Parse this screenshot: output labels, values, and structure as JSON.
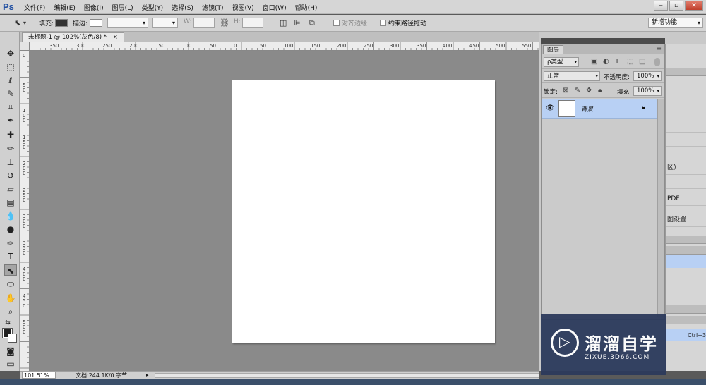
{
  "app": {
    "logo": "Ps"
  },
  "menu": [
    "文件(F)",
    "编辑(E)",
    "图像(I)",
    "图层(L)",
    "类型(Y)",
    "选择(S)",
    "滤镜(T)",
    "视图(V)",
    "窗口(W)",
    "帮助(H)"
  ],
  "window_controls": [
    "‒",
    "▫",
    "✕"
  ],
  "options": {
    "fill_label": "填充:",
    "stroke_label": "描边:",
    "w_label": "W:",
    "h_label": "H:",
    "align_edges": "对齐边缘",
    "constrain_path": "约束路径拖动",
    "workspace": "新增功能"
  },
  "document": {
    "tab_title": "未标题-1 @ 102%(灰色/8) *",
    "close": "×"
  },
  "ruler_top_labels": [
    "350",
    "300",
    "250",
    "200",
    "150",
    "100",
    "50",
    "0",
    "50",
    "100",
    "150",
    "200",
    "250",
    "300",
    "350",
    "400",
    "450",
    "500",
    "550",
    "600",
    "650",
    "700",
    "750",
    "800",
    "850"
  ],
  "ruler_left_labels": [
    "0",
    "50",
    "100",
    "150",
    "200",
    "250",
    "300",
    "350",
    "400",
    "450",
    "500"
  ],
  "status": {
    "zoom": "101.51%",
    "doc_info": "文档:244.1K/0 字节"
  },
  "layers_panel": {
    "title": "图层",
    "filter_kind": "ρ类型",
    "blend_mode": "正常",
    "opacity_label": "不透明度:",
    "opacity_value": "100%",
    "lock_label": "锁定:",
    "fill_label": "填充:",
    "fill_value": "100%",
    "layer_name": "背景"
  },
  "right_edge": {
    "row1": "区）",
    "row2": "PDF",
    "row3": "图设置",
    "shortcut": "Ctrl+3"
  },
  "watermark": {
    "cn": "溜溜自学",
    "url": "ZIXUE.3D66.COM"
  },
  "icons": {
    "tools": [
      "move-icon",
      "marquee-icon",
      "lasso-icon",
      "quick-select-icon",
      "crop-icon",
      "eyedropper-icon",
      "healing-icon",
      "brush-icon",
      "stamp-icon",
      "history-brush-icon",
      "eraser-icon",
      "gradient-icon",
      "blur-icon",
      "dodge-icon",
      "pen-icon",
      "type-icon",
      "path-select-icon",
      "ellipse-icon",
      "hand-icon",
      "zoom-icon"
    ]
  }
}
